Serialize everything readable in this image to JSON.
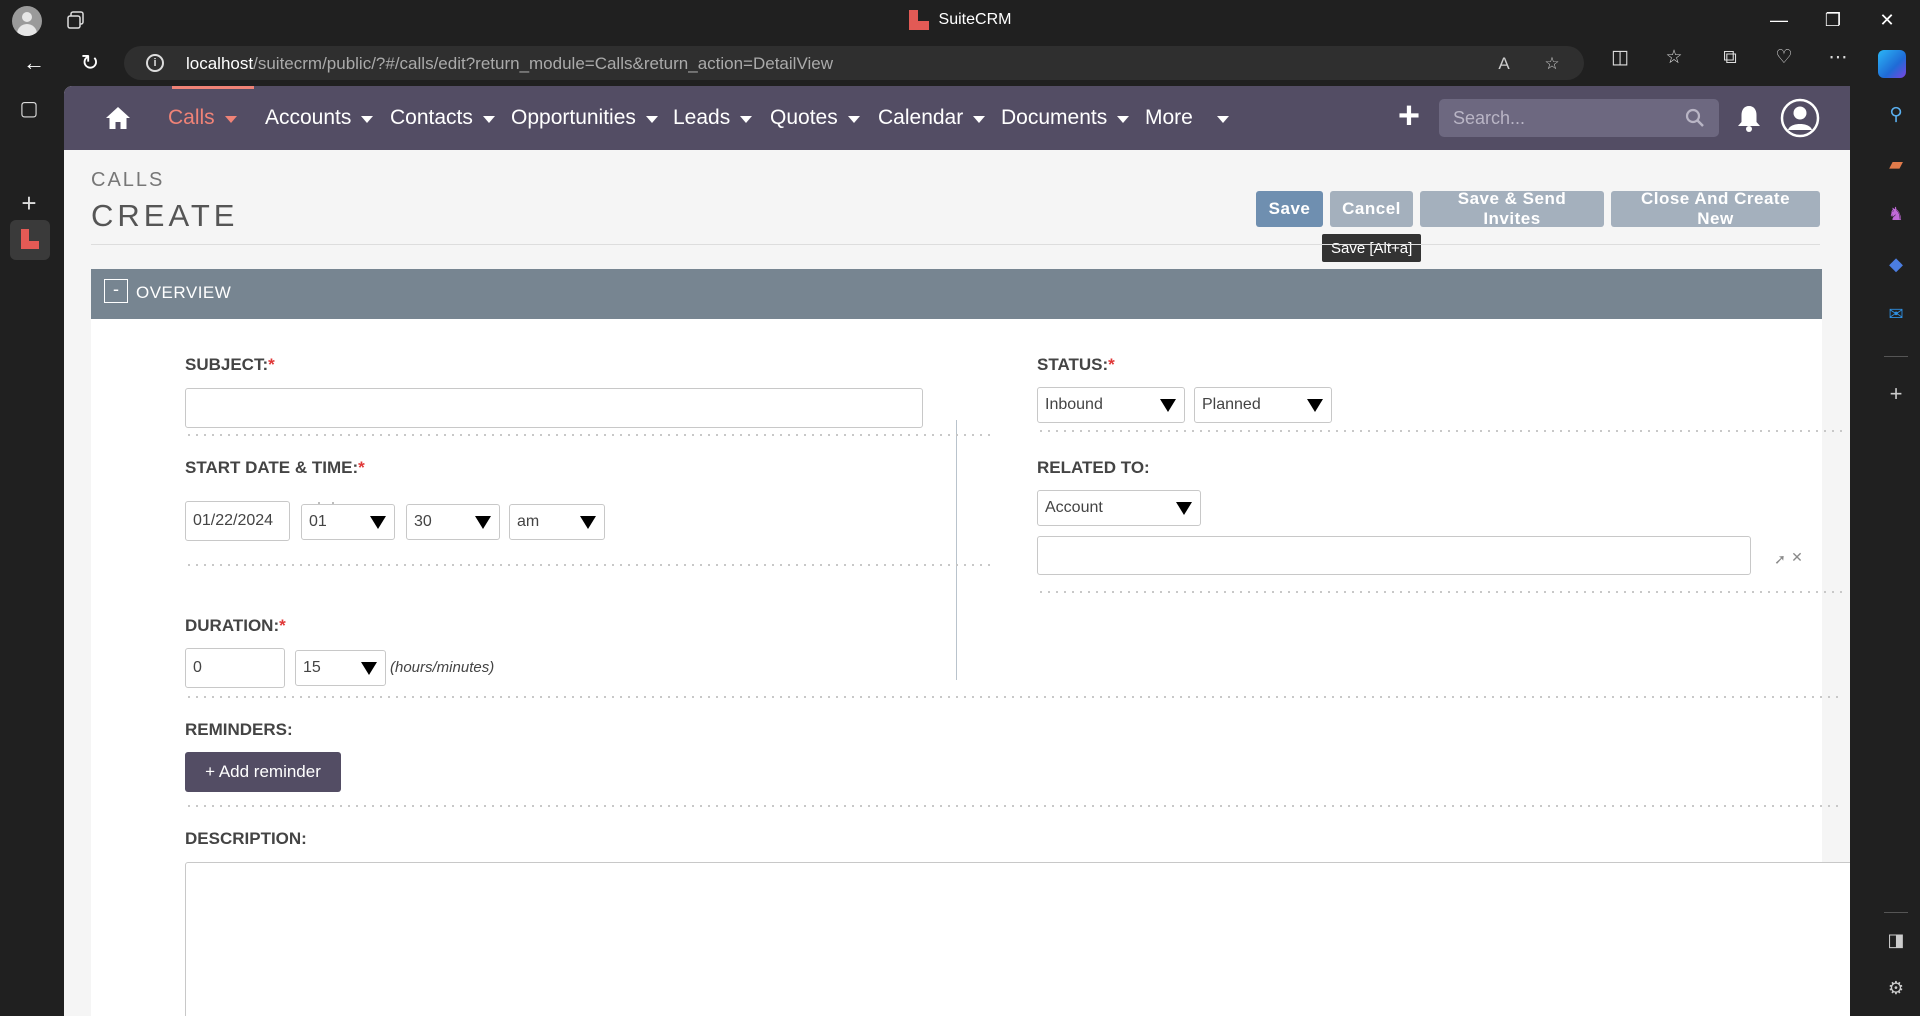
{
  "window": {
    "title": "SuiteCRM",
    "minimize": "—",
    "restore": "❐",
    "close": "✕"
  },
  "address": {
    "host": "localhost",
    "path": "/suitecrm/public/?#/calls/edit?return_module=Calls&return_action=DetailView"
  },
  "nav": {
    "items": [
      {
        "label": "Calls"
      },
      {
        "label": "Accounts"
      },
      {
        "label": "Contacts"
      },
      {
        "label": "Opportunities"
      },
      {
        "label": "Leads"
      },
      {
        "label": "Quotes"
      },
      {
        "label": "Calendar"
      },
      {
        "label": "Documents"
      },
      {
        "label": "More"
      }
    ],
    "search_placeholder": "Search..."
  },
  "header": {
    "module": "CALLS",
    "title": "CREATE"
  },
  "actions": {
    "save": "Save",
    "cancel": "Cancel",
    "save_send": "Save & Send Invites",
    "close_create": "Close And Create New",
    "tooltip": "Save [Alt+a]"
  },
  "panel": {
    "collapse": "-",
    "title": "OVERVIEW"
  },
  "form": {
    "subject": {
      "label": "SUBJECT:",
      "required": "*",
      "value": ""
    },
    "status": {
      "label": "STATUS:",
      "required": "*",
      "direction": "Inbound",
      "state": "Planned"
    },
    "start": {
      "label": "START DATE & TIME:",
      "required": "*",
      "date": "01/22/2024",
      "hour": "01",
      "separator": ":",
      "minute": "30",
      "ampm": "am"
    },
    "related": {
      "label": "RELATED TO:",
      "type": "Account",
      "value": ""
    },
    "duration": {
      "label": "DURATION:",
      "required": "*",
      "hours": "0",
      "minutes": "15",
      "hint": "(hours/minutes)"
    },
    "reminders": {
      "label": "REMINDERS:",
      "button": "+ Add reminder"
    },
    "description": {
      "label": "DESCRIPTION:",
      "value": ""
    }
  },
  "colors": {
    "navbar": "#534d64",
    "accent": "#f08377",
    "panel_header": "#778591",
    "save_button": "#6f8fb0",
    "secondary_button": "#a4b0bd"
  }
}
